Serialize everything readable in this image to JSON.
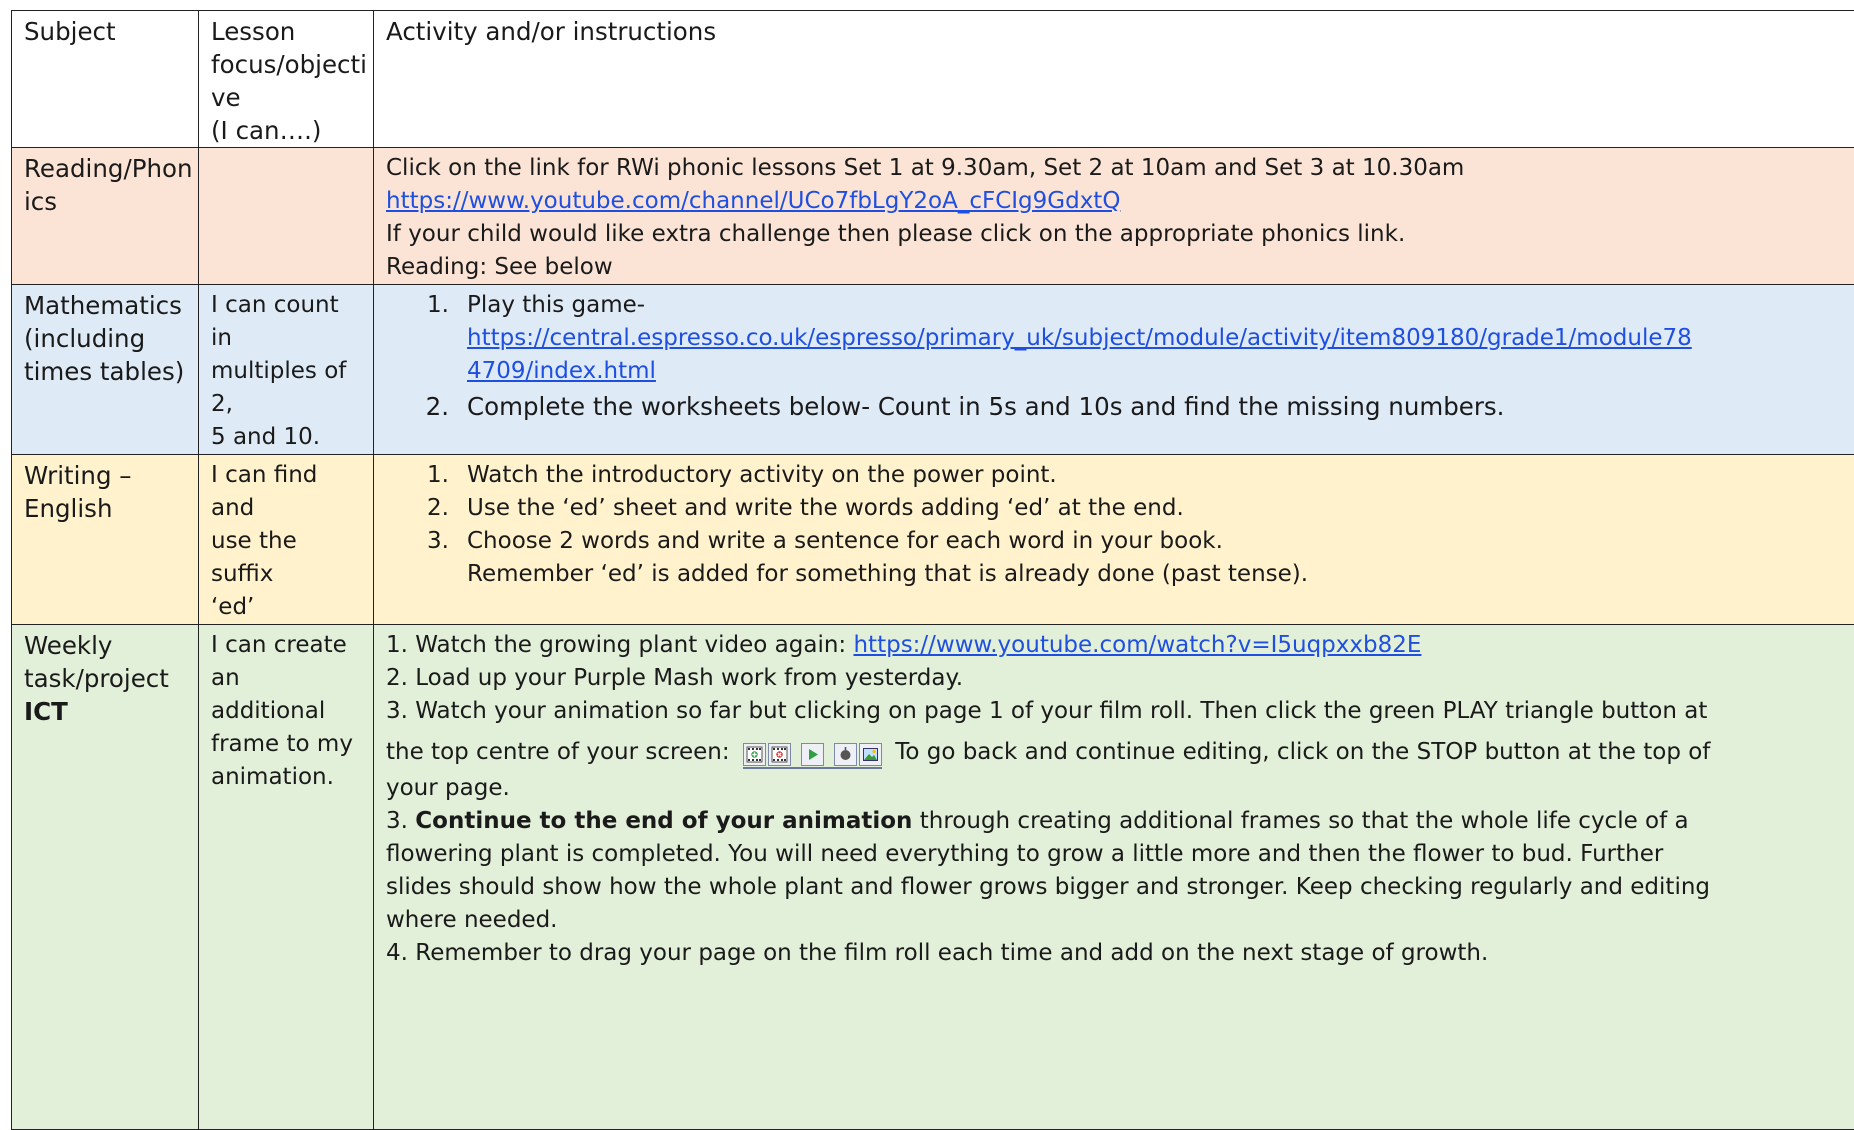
{
  "header": {
    "subject": "Subject",
    "focus": "Lesson\nfocus/objecti\nve\n(I can….)",
    "activity": "Activity and/or instructions"
  },
  "colors": {
    "reading_bg": "#fbe4d5",
    "maths_bg": "#deeaf6",
    "writing_bg": "#fff2cc",
    "ict_bg": "#e2efd9",
    "link": "#1f4fe0",
    "play_green": "#2ea043"
  },
  "rows": {
    "reading": {
      "subject": "Reading/Phon\nics",
      "focus": "",
      "line1": "Click on the link for RWi phonic lessons Set 1 at 9.30am, Set 2 at 10am and Set 3 at 10.30am",
      "link": "https://www.youtube.com/channel/UCo7fbLgY2oA_cFCIg9GdxtQ",
      "line3": "If your child would like extra challenge then please click on the appropriate phonics link.",
      "line4": "Reading: See below"
    },
    "maths": {
      "subject": "Mathematics\n(including\ntimes tables)",
      "focus": "I can count in\nmultiples of 2,\n5 and 10.",
      "step1_num": "1.",
      "step1_text": "Play this game-",
      "link_part1": "https://central.espresso.co.uk/espresso/primary_uk/subject/module/activity/item809180/grade1/module78",
      "link_part2": "4709/index.html",
      "step2_num": "2.",
      "step2_text": "Complete the worksheets below- Count in 5s and 10s and find the missing numbers."
    },
    "writing": {
      "subject": "Writing –\nEnglish",
      "focus": "I can find and\nuse the suffix\n‘ed’",
      "steps": [
        {
          "num": "1.",
          "text": "Watch the introductory activity on the power point."
        },
        {
          "num": "2.",
          "text": "Use the ‘ed’ sheet and write the words adding ‘ed’ at the end."
        },
        {
          "num": "3.",
          "text": "Choose 2 words and write a sentence for each word in your book."
        }
      ],
      "note": "Remember ‘ed’ is added for something that is already done (past tense)."
    },
    "ict": {
      "subject_line1": "Weekly",
      "subject_line2": "task/project",
      "subject_bold": "ICT",
      "focus": "I can create an\nadditional\nframe to my\nanimation.",
      "p1_text": "1. Watch the growing plant video again: ",
      "p1_link": "https://www.youtube.com/watch?v=I5uqpxxb82E",
      "p2": "2. Load up your Purple Mash work from yesterday.",
      "p3a": "3. Watch your animation so far but clicking on page 1 of your film roll. Then click the green PLAY triangle button at",
      "p3b": "the top centre of your screen: ",
      "p3c": " To go back and continue editing, click on the STOP button at the top of",
      "p3d": "your page.",
      "p4_prefix": "3. ",
      "p4_bold": "Continue to the end of your animation",
      "p4_l1": " through creating additional frames so that the whole life cycle of a",
      "p4_l2": "flowering plant is completed. You will need everything to grow a little more and then the flower to bud.  Further",
      "p4_l3": "slides should show how the whole plant and flower grows bigger and stronger. Keep checking regularly and editing",
      "p4_l4": "where needed.",
      "p5": "4. Remember to drag your page on the film roll each time and add on the next stage of growth."
    }
  }
}
